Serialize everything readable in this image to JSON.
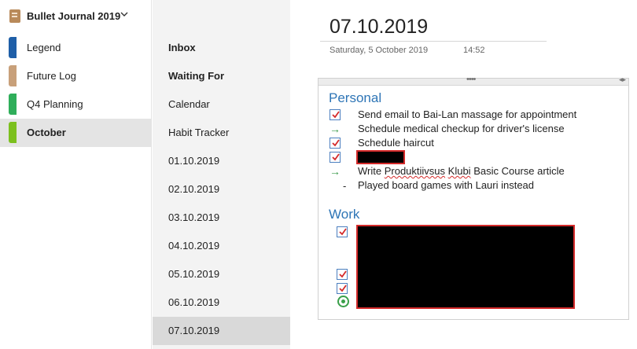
{
  "notebook": {
    "title": "Bullet Journal 2019",
    "color": "#b98a5a"
  },
  "sections": [
    {
      "label": "Legend",
      "color": "#1f5fa8",
      "active": false
    },
    {
      "label": "Future Log",
      "color": "#c8a07a",
      "active": false
    },
    {
      "label": "Q4 Planning",
      "color": "#2fae5a",
      "active": false
    },
    {
      "label": "October",
      "color": "#7cc01e",
      "active": true
    }
  ],
  "pages": [
    {
      "label": "Inbox",
      "bold": true,
      "active": false
    },
    {
      "label": "Waiting For",
      "bold": true,
      "active": false
    },
    {
      "label": "Calendar",
      "bold": false,
      "active": false
    },
    {
      "label": "Habit Tracker",
      "bold": false,
      "active": false
    },
    {
      "label": "01.10.2019",
      "bold": false,
      "active": false
    },
    {
      "label": "02.10.2019",
      "bold": false,
      "active": false
    },
    {
      "label": "03.10.2019",
      "bold": false,
      "active": false
    },
    {
      "label": "04.10.2019",
      "bold": false,
      "active": false
    },
    {
      "label": "05.10.2019",
      "bold": false,
      "active": false
    },
    {
      "label": "06.10.2019",
      "bold": false,
      "active": false
    },
    {
      "label": "07.10.2019",
      "bold": false,
      "active": true
    }
  ],
  "page": {
    "title": "07.10.2019",
    "date": "Saturday, 5 October 2019",
    "time": "14:52"
  },
  "note": {
    "personal_heading": "Personal",
    "personal_items": [
      {
        "type": "checked",
        "text": "Send email to Bai-Lan massage for appointment"
      },
      {
        "type": "migrated",
        "text": "Schedule medical checkup for driver's license"
      },
      {
        "type": "checked",
        "text": "Schedule haircut"
      },
      {
        "type": "checked-redacted",
        "text": ""
      },
      {
        "type": "migrated",
        "text_a": "Write ",
        "text_b": "Produktiivsus",
        "text_c": " ",
        "text_d": "Klubi",
        "text_e": " Basic Course article"
      },
      {
        "type": "note",
        "text": "Played board games with Lauri instead"
      }
    ],
    "work_heading": "Work",
    "work_marks": [
      "checked",
      "checked",
      "checked",
      "target"
    ]
  },
  "colors": {
    "heading": "#2e75b6",
    "check": "#d42a2a",
    "migrated_arrow": "#3a9a4a",
    "redaction_border": "#d42a2a"
  }
}
